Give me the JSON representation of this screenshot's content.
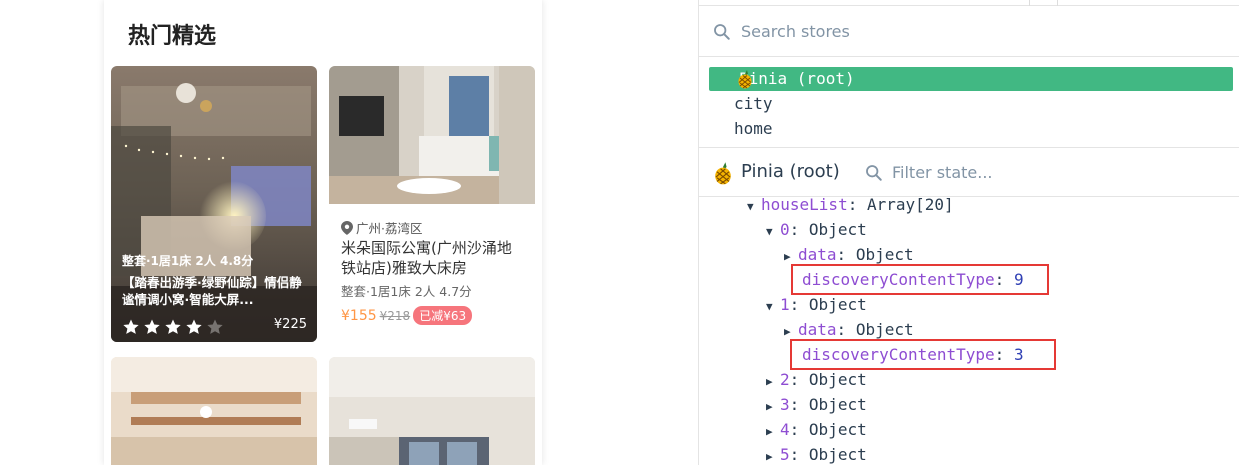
{
  "app": {
    "section_title": "热门精选"
  },
  "cards": [
    {
      "desc": "整套·1居1床 2人 4.8分",
      "title": "【踏春出游季·绿野仙踪】情侣静谧情调小窝·智能大屏...",
      "rating": 4,
      "rating_max": 5,
      "price": "¥225"
    },
    {
      "location": "广州·荔湾区",
      "name": "米朵国际公寓(广州沙涌地铁站店)雅致大床房",
      "desc": "整套·1居1床 2人 4.7分",
      "price": "¥155",
      "original_price": "¥218",
      "discount": "已减¥63"
    }
  ],
  "devtools": {
    "search": {
      "placeholder": "Search stores",
      "value": ""
    },
    "stores": [
      {
        "label": "Pinia (root)",
        "active": true,
        "icon": "pineapple-icon"
      },
      {
        "label": "city",
        "active": false
      },
      {
        "label": "home",
        "active": false
      }
    ],
    "state_header": {
      "title": "Pinia (root)",
      "filter_placeholder": "Filter state..."
    },
    "tree": {
      "houseList": {
        "key": "houseList",
        "sep": ":",
        "value": "Array[20]"
      },
      "item0": {
        "key": "0",
        "sep": ":",
        "value": "Object"
      },
      "item0_data": {
        "key": "data",
        "sep": ":",
        "value": "Object"
      },
      "item0_type": {
        "key": "discoveryContentType",
        "sep": ":",
        "value": "9"
      },
      "item1": {
        "key": "1",
        "sep": ":",
        "value": "Object"
      },
      "item1_data": {
        "key": "data",
        "sep": ":",
        "value": "Object"
      },
      "item1_type": {
        "key": "discoveryContentType",
        "sep": ":",
        "value": "3"
      },
      "item2": {
        "key": "2",
        "sep": ":",
        "value": "Object"
      },
      "item3": {
        "key": "3",
        "sep": ":",
        "value": "Object"
      },
      "item4": {
        "key": "4",
        "sep": ":",
        "value": "Object"
      },
      "item5": {
        "key": "5",
        "sep": ":",
        "value": "Object"
      }
    },
    "colors": {
      "active_store": "#41b883",
      "key": "#8e4dd2",
      "number": "#2f3fb4",
      "highlight": "#e53935"
    }
  }
}
